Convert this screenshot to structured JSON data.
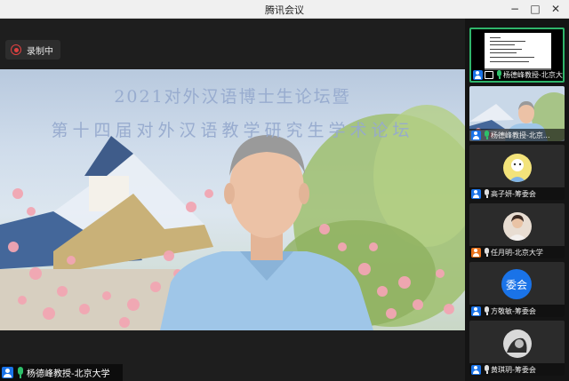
{
  "window": {
    "title": "腾讯会议"
  },
  "recording": {
    "label": "录制中"
  },
  "main_video": {
    "banner_line1": "2021对外汉语博士生论坛暨",
    "banner_line2": "第十四届对外汉语教学研究生学术论坛",
    "speaker_name": "杨德峰教授-北京大学"
  },
  "participants": [
    {
      "name": "杨德峰教授-北京大",
      "kind": "screen-share",
      "mic": "on",
      "active": true
    },
    {
      "name": "杨德峰教授-北京...",
      "kind": "video",
      "mic": "on",
      "active": false
    },
    {
      "name": "高子妍-筹委会",
      "kind": "avatar",
      "mic": "off",
      "active": false
    },
    {
      "name": "任月明-北京大学",
      "kind": "avatar",
      "mic": "off",
      "active": false
    },
    {
      "name": "方敬敏-筹委会",
      "kind": "text-avatar",
      "avatar_text": "委会",
      "mic": "off",
      "active": false
    },
    {
      "name": "黄琪玥-筹委会",
      "kind": "avatar",
      "mic": "off",
      "active": false
    }
  ],
  "colors": {
    "accent": "#1a73e8",
    "mic_on": "#2ec06a",
    "recording": "#e04141",
    "active_border": "#2fb56a"
  }
}
